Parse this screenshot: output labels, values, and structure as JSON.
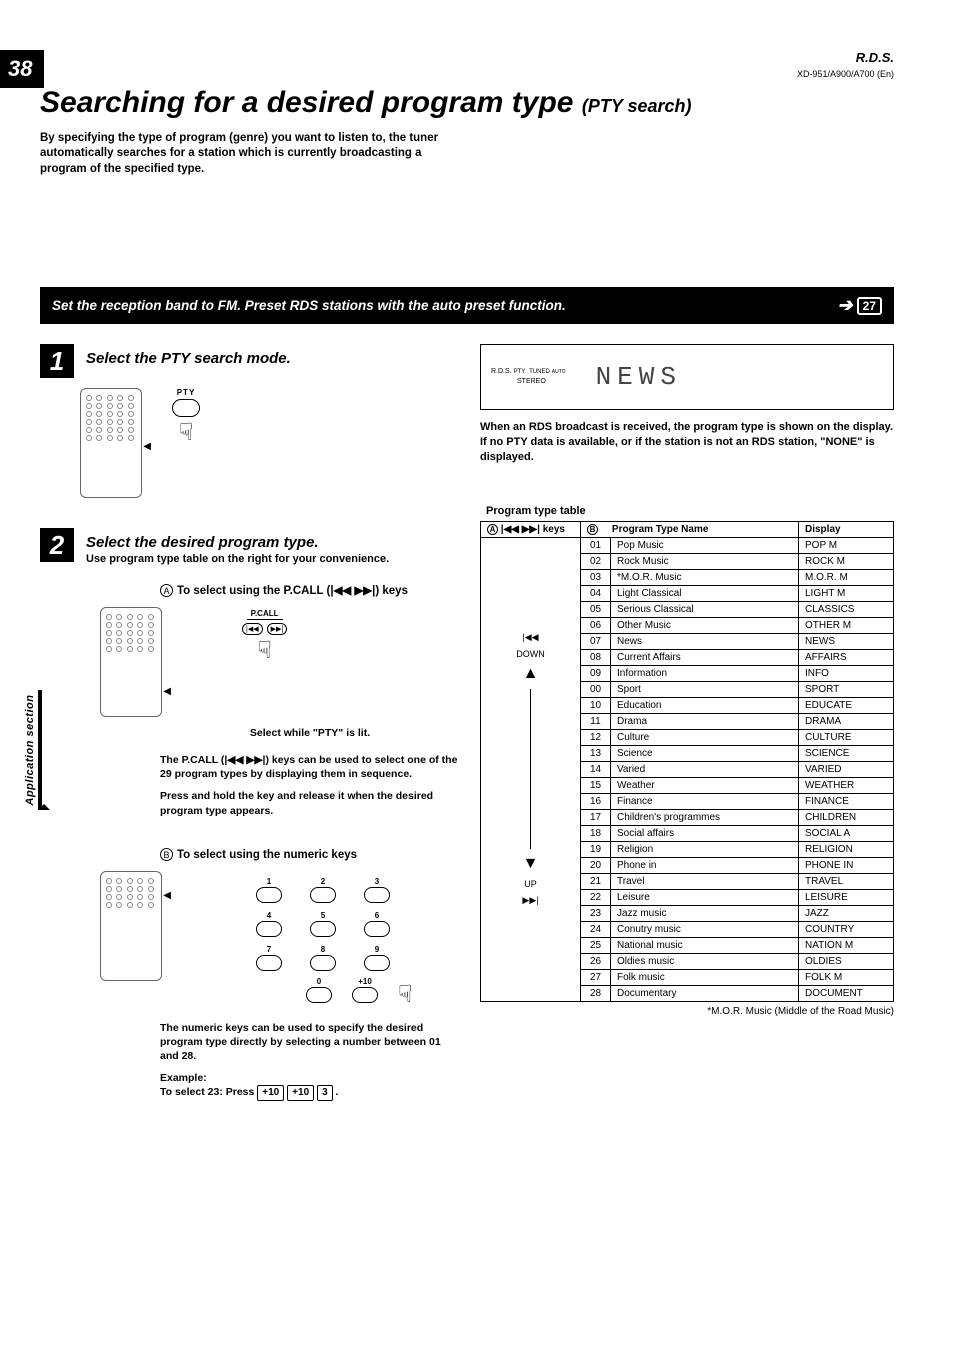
{
  "page_number": "38",
  "header_right": "R.D.S.",
  "model_line": "XD-951/A900/A700 (En)",
  "title_main": "Searching for a desired program type",
  "title_sub": "(PTY search)",
  "intro": "By specifying the type of program (genre) you want to listen to, the tuner automatically searches for a station which is currently broadcasting a program of the specified type.",
  "banner_text": "Set the reception band to FM. Preset RDS stations with the auto preset function.",
  "banner_ref": "27",
  "step1_title": "Select the PTY search mode.",
  "pty_label": "PTY",
  "display": {
    "tag1": "R.D.S.",
    "tag2": "PTY",
    "tag3": "TUNED",
    "tag4": "AUTO",
    "tag5": "STEREO",
    "main": "NEWS"
  },
  "right_body": "When an RDS broadcast is received, the program type is shown on the display. If no PTY data is available, or if the station is not an RDS station, \"NONE\" is displayed.",
  "step2_title": "Select the desired program type.",
  "step2_sub": "Use program type table on the right for your convenience.",
  "methodA_title": "To select using the P.CALL (|◀◀ ▶▶|) keys",
  "pcall_label": "P.CALL",
  "captionA": "Select while \"PTY\" is lit.",
  "bodyA1": "The P.CALL (|◀◀ ▶▶|) keys can be used to select one of the 29 program types by displaying them in sequence.",
  "bodyA2": "Press and hold the key and release it when the desired program type appears.",
  "methodB_title": "To select using the numeric keys",
  "numeric": [
    "1",
    "2",
    "3",
    "4",
    "5",
    "6",
    "7",
    "8",
    "9",
    "0",
    "+10"
  ],
  "bodyB1": "The numeric keys can be used to specify the desired program type directly by selecting a number between 01 and 28.",
  "example_label": "Example:",
  "example_text": "To select 23: Press",
  "example_keys": [
    "+10",
    "+10",
    "3"
  ],
  "example_end": ".",
  "table_title": "Program type table",
  "table_head": {
    "colA": "|◀◀ ▶▶| keys",
    "colB_num": "",
    "colB_name": "Program Type Name",
    "colB_disp": "Display"
  },
  "keys_down": "DOWN",
  "keys_up": "UP",
  "rows": [
    {
      "n": "01",
      "name": "Pop Music",
      "d": "POP M"
    },
    {
      "n": "02",
      "name": "Rock Music",
      "d": "ROCK M"
    },
    {
      "n": "03",
      "name": "*M.O.R. Music",
      "d": "M.O.R. M"
    },
    {
      "n": "04",
      "name": "Light Classical",
      "d": "LIGHT M"
    },
    {
      "n": "05",
      "name": "Serious Classical",
      "d": "CLASSICS"
    },
    {
      "n": "06",
      "name": "Other Music",
      "d": "OTHER M"
    },
    {
      "n": "07",
      "name": "News",
      "d": "NEWS"
    },
    {
      "n": "08",
      "name": "Current Affairs",
      "d": "AFFAIRS"
    },
    {
      "n": "09",
      "name": "Information",
      "d": "INFO"
    },
    {
      "n": "00",
      "name": "Sport",
      "d": "SPORT"
    },
    {
      "n": "10",
      "name": "Education",
      "d": "EDUCATE"
    },
    {
      "n": "11",
      "name": "Drama",
      "d": "DRAMA"
    },
    {
      "n": "12",
      "name": "Culture",
      "d": "CULTURE"
    },
    {
      "n": "13",
      "name": "Science",
      "d": "SCIENCE"
    },
    {
      "n": "14",
      "name": "Varied",
      "d": "VARIED"
    },
    {
      "n": "15",
      "name": "Weather",
      "d": "WEATHER"
    },
    {
      "n": "16",
      "name": "Finance",
      "d": "FINANCE"
    },
    {
      "n": "17",
      "name": "Children's programmes",
      "d": "CHILDREN"
    },
    {
      "n": "18",
      "name": "Social affairs",
      "d": "SOCIAL A"
    },
    {
      "n": "19",
      "name": "Religion",
      "d": "RELIGION"
    },
    {
      "n": "20",
      "name": "Phone in",
      "d": "PHONE IN"
    },
    {
      "n": "21",
      "name": "Travel",
      "d": "TRAVEL"
    },
    {
      "n": "22",
      "name": "Leisure",
      "d": "LEISURE"
    },
    {
      "n": "23",
      "name": "Jazz music",
      "d": "JAZZ"
    },
    {
      "n": "24",
      "name": "Conutry music",
      "d": "COUNTRY"
    },
    {
      "n": "25",
      "name": "National music",
      "d": "NATION M"
    },
    {
      "n": "26",
      "name": "Oldies music",
      "d": "OLDIES"
    },
    {
      "n": "27",
      "name": "Folk music",
      "d": "FOLK M"
    },
    {
      "n": "28",
      "name": "Documentary",
      "d": "DOCUMENT"
    }
  ],
  "footnote": "*M.O.R. Music (Middle of the Road Music)",
  "side_tab": "Application section",
  "circled_A": "A",
  "circled_B": "B"
}
